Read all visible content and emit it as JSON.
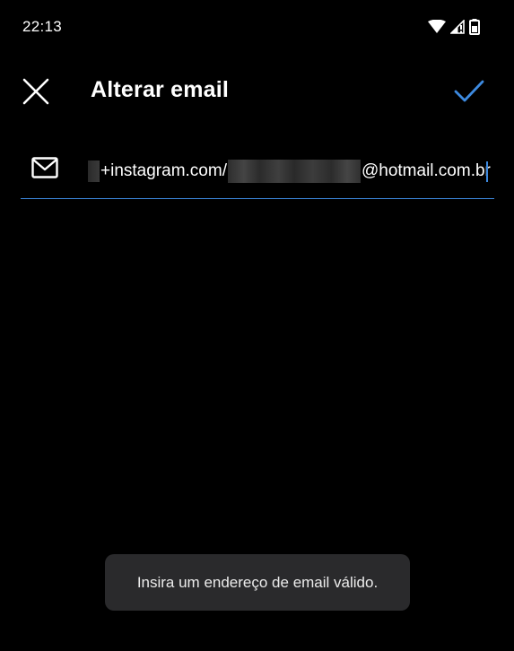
{
  "status_bar": {
    "time": "22:13",
    "icons": [
      "wifi-icon",
      "signal-icon",
      "battery-icon"
    ]
  },
  "toolbar": {
    "title": "Alterar email",
    "close_icon": "close-icon",
    "confirm_icon": "check-icon"
  },
  "email_field": {
    "icon": "mail-icon",
    "value_prefix": "+instagram.com/",
    "value_suffix": "@hotmail.com.br"
  },
  "toast": {
    "message": "Insira um endereço de email válido."
  },
  "colors": {
    "background": "#000000",
    "accent": "#3d8ae0",
    "toast_bg": "#2a2a2c",
    "text": "#ffffff"
  }
}
